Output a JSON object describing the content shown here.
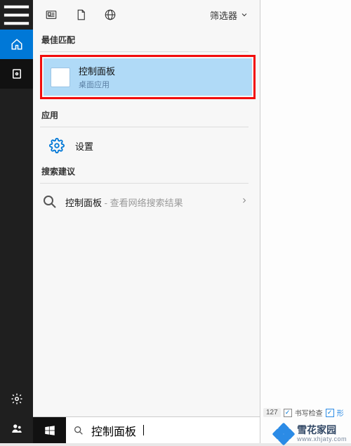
{
  "filter_label": "筛选器",
  "sections": {
    "best_match": "最佳匹配",
    "apps": "应用",
    "search_suggestions": "搜索建议"
  },
  "best_match_result": {
    "title": "控制面板",
    "subtitle": "桌面应用"
  },
  "apps_result": {
    "title": "设置"
  },
  "suggestion": {
    "prefix": "控制面板",
    "suffix": " - 查看网络搜索结果"
  },
  "search_value": "控制面板",
  "right_panel": {
    "count": "127",
    "scan_label": "书写检查",
    "extra": "形"
  },
  "watermark": {
    "title": "雪花家园",
    "url": "www.xhjaty.com"
  }
}
